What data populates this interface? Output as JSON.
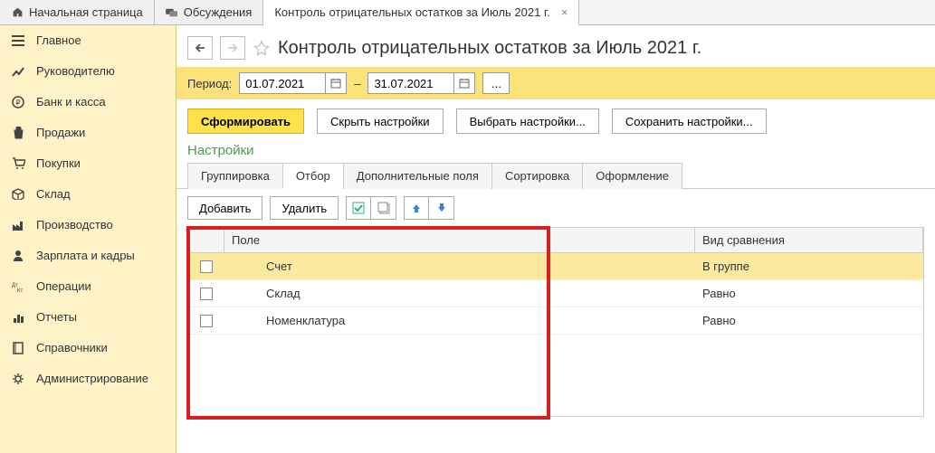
{
  "tabs": [
    {
      "label": "Начальная страница"
    },
    {
      "label": "Обсуждения"
    },
    {
      "label": "Контроль отрицательных остатков за Июль 2021 г."
    }
  ],
  "sidebar": {
    "items": [
      {
        "label": "Главное"
      },
      {
        "label": "Руководителю"
      },
      {
        "label": "Банк и касса"
      },
      {
        "label": "Продажи"
      },
      {
        "label": "Покупки"
      },
      {
        "label": "Склад"
      },
      {
        "label": "Производство"
      },
      {
        "label": "Зарплата и кадры"
      },
      {
        "label": "Операции"
      },
      {
        "label": "Отчеты"
      },
      {
        "label": "Справочники"
      },
      {
        "label": "Администрирование"
      }
    ]
  },
  "page": {
    "title": "Контроль отрицательных остатков за Июль 2021 г."
  },
  "period": {
    "label": "Период:",
    "from": "01.07.2021",
    "dash": "–",
    "to": "31.07.2021",
    "dots": "..."
  },
  "actions": {
    "form": "Сформировать",
    "hide": "Скрыть настройки",
    "choose": "Выбрать настройки...",
    "save": "Сохранить настройки..."
  },
  "settings_title": "Настройки",
  "subtabs": [
    "Группировка",
    "Отбор",
    "Дополнительные поля",
    "Сортировка",
    "Оформление"
  ],
  "toolbar": {
    "add": "Добавить",
    "delete": "Удалить"
  },
  "grid": {
    "headers": {
      "field": "Поле",
      "comparison": "Вид сравнения"
    },
    "rows": [
      {
        "field": "Счет",
        "comparison": "В группе"
      },
      {
        "field": "Склад",
        "comparison": "Равно"
      },
      {
        "field": "Номенклатура",
        "comparison": "Равно"
      }
    ]
  }
}
